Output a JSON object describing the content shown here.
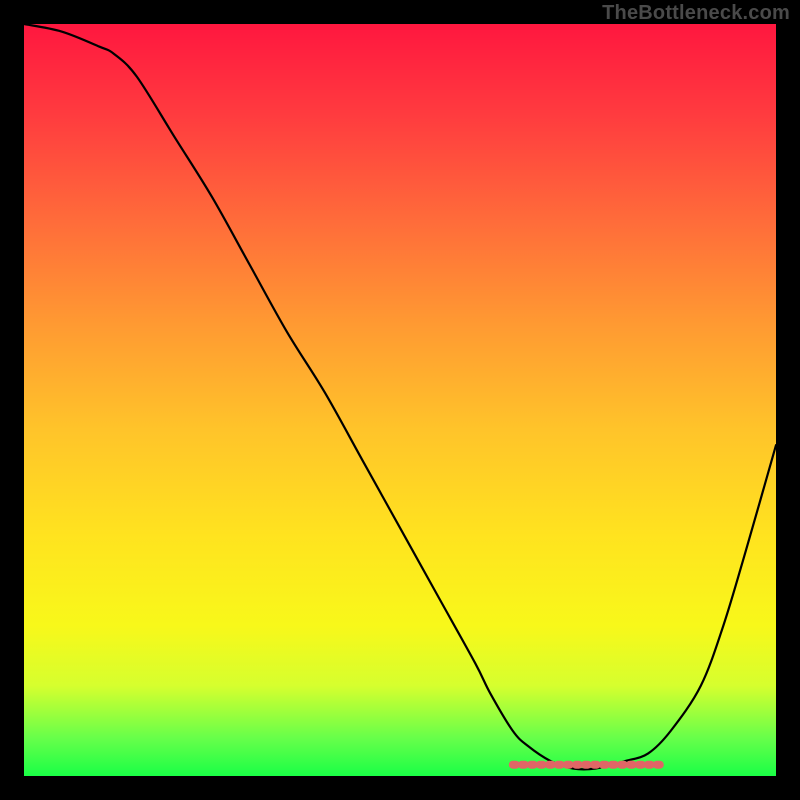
{
  "attribution": "TheBottleneck.com",
  "colors": {
    "border": "#000000",
    "curve": "#000000",
    "marker_band": "#e06666",
    "gradient_top": "#ff173f",
    "gradient_bottom": "#1aff46"
  },
  "chart_data": {
    "type": "line",
    "title": "",
    "xlabel": "",
    "ylabel": "",
    "xlim": [
      0,
      100
    ],
    "ylim": [
      0,
      100
    ],
    "x": [
      0,
      5,
      10,
      12,
      15,
      20,
      25,
      30,
      35,
      40,
      45,
      50,
      55,
      60,
      62,
      65,
      67,
      70,
      73,
      76,
      80,
      83,
      86,
      90,
      93,
      96,
      100
    ],
    "y": [
      100,
      99,
      97,
      96,
      93,
      85,
      77,
      68,
      59,
      51,
      42,
      33,
      24,
      15,
      11,
      6,
      4,
      2,
      1,
      1,
      2,
      3,
      6,
      12,
      20,
      30,
      44
    ],
    "marker_band": {
      "x_start": 65,
      "x_end": 85,
      "y": 1.5
    },
    "annotations": []
  }
}
